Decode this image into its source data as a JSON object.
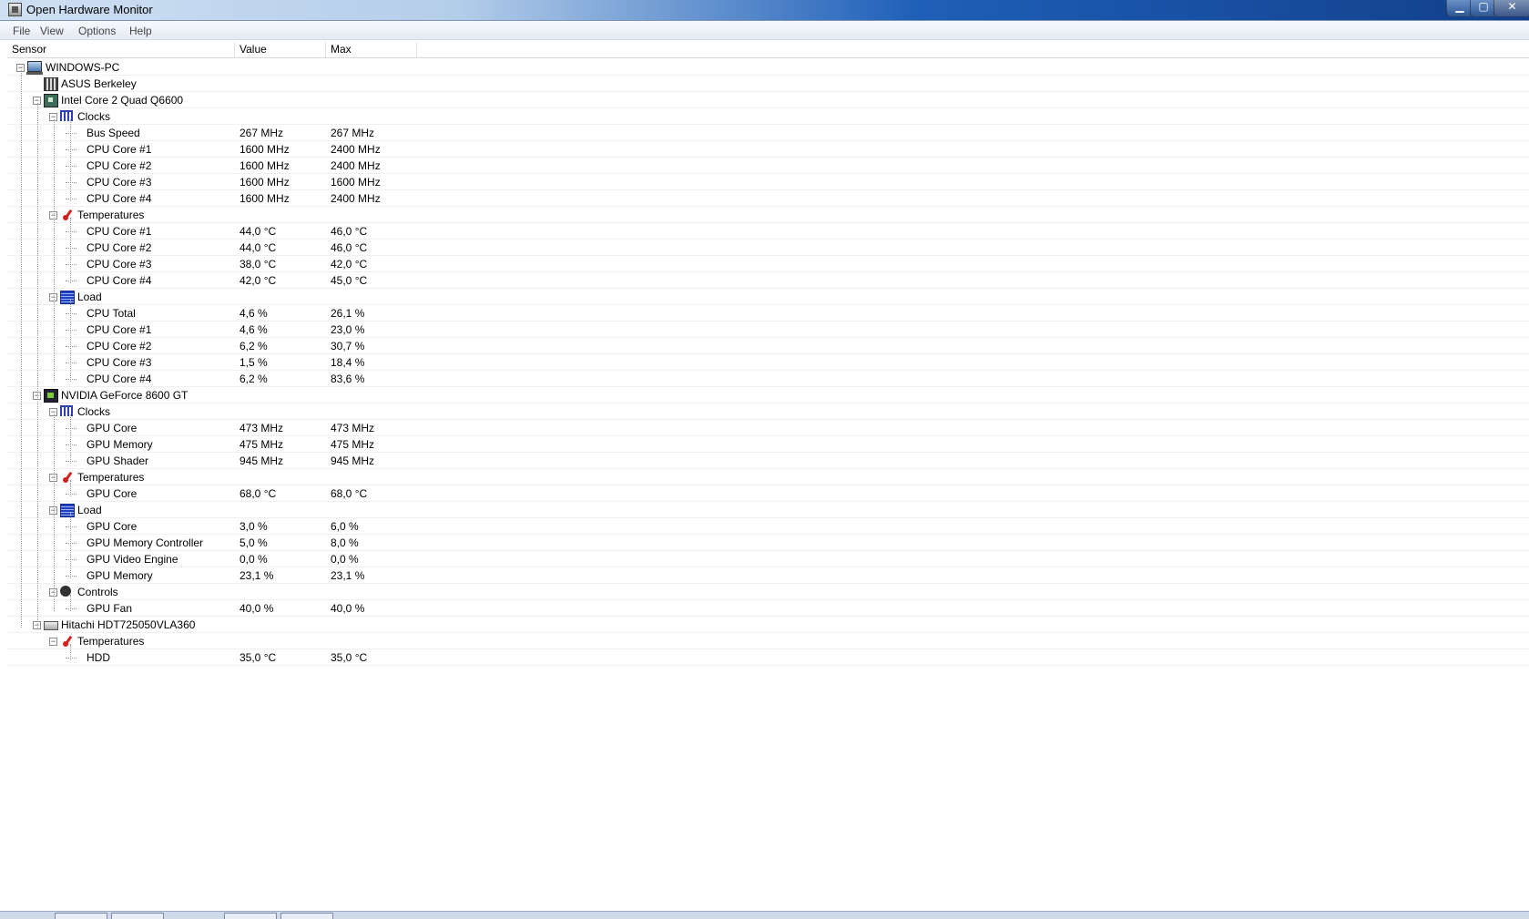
{
  "window": {
    "title": "Open Hardware Monitor",
    "controls": {
      "minimize": "▁",
      "maximize": "▢",
      "close": "✕"
    }
  },
  "menu": [
    "File",
    "View",
    "Options",
    "Help"
  ],
  "columns": {
    "sensor": "Sensor",
    "value": "Value",
    "max": "Max"
  },
  "rows": [
    {
      "level": 0,
      "expander": "−",
      "icon": "computer",
      "label": "WINDOWS-PC",
      "value": "",
      "max": ""
    },
    {
      "level": 1,
      "expander": "",
      "icon": "board",
      "label": "ASUS Berkeley",
      "value": "",
      "max": ""
    },
    {
      "level": 1,
      "expander": "−",
      "icon": "cpu",
      "label": "Intel Core 2 Quad Q6600",
      "value": "",
      "max": ""
    },
    {
      "level": 2,
      "expander": "−",
      "icon": "clock",
      "label": "Clocks",
      "value": "",
      "max": ""
    },
    {
      "level": 3,
      "expander": "",
      "icon": "",
      "label": "Bus Speed",
      "value": "267 MHz",
      "max": "267 MHz"
    },
    {
      "level": 3,
      "expander": "",
      "icon": "",
      "label": "CPU Core #1",
      "value": "1600 MHz",
      "max": "2400 MHz"
    },
    {
      "level": 3,
      "expander": "",
      "icon": "",
      "label": "CPU Core #2",
      "value": "1600 MHz",
      "max": "2400 MHz"
    },
    {
      "level": 3,
      "expander": "",
      "icon": "",
      "label": "CPU Core #3",
      "value": "1600 MHz",
      "max": "1600 MHz"
    },
    {
      "level": 3,
      "expander": "",
      "icon": "",
      "label": "CPU Core #4",
      "value": "1600 MHz",
      "max": "2400 MHz"
    },
    {
      "level": 2,
      "expander": "−",
      "icon": "temp",
      "label": "Temperatures",
      "value": "",
      "max": ""
    },
    {
      "level": 3,
      "expander": "",
      "icon": "",
      "label": "CPU Core #1",
      "value": "44,0 °C",
      "max": "46,0 °C"
    },
    {
      "level": 3,
      "expander": "",
      "icon": "",
      "label": "CPU Core #2",
      "value": "44,0 °C",
      "max": "46,0 °C"
    },
    {
      "level": 3,
      "expander": "",
      "icon": "",
      "label": "CPU Core #3",
      "value": "38,0 °C",
      "max": "42,0 °C"
    },
    {
      "level": 3,
      "expander": "",
      "icon": "",
      "label": "CPU Core #4",
      "value": "42,0 °C",
      "max": "45,0 °C"
    },
    {
      "level": 2,
      "expander": "−",
      "icon": "load",
      "label": "Load",
      "value": "",
      "max": ""
    },
    {
      "level": 3,
      "expander": "",
      "icon": "",
      "label": "CPU Total",
      "value": "4,6 %",
      "max": "26,1 %"
    },
    {
      "level": 3,
      "expander": "",
      "icon": "",
      "label": "CPU Core #1",
      "value": "4,6 %",
      "max": "23,0 %"
    },
    {
      "level": 3,
      "expander": "",
      "icon": "",
      "label": "CPU Core #2",
      "value": "6,2 %",
      "max": "30,7 %"
    },
    {
      "level": 3,
      "expander": "",
      "icon": "",
      "label": "CPU Core #3",
      "value": "1,5 %",
      "max": "18,4 %"
    },
    {
      "level": 3,
      "expander": "",
      "icon": "",
      "label": "CPU Core #4",
      "value": "6,2 %",
      "max": "83,6 %"
    },
    {
      "level": 1,
      "expander": "−",
      "icon": "gpu",
      "label": "NVIDIA GeForce 8600 GT",
      "value": "",
      "max": ""
    },
    {
      "level": 2,
      "expander": "−",
      "icon": "clock",
      "label": "Clocks",
      "value": "",
      "max": ""
    },
    {
      "level": 3,
      "expander": "",
      "icon": "",
      "label": "GPU Core",
      "value": "473 MHz",
      "max": "473 MHz"
    },
    {
      "level": 3,
      "expander": "",
      "icon": "",
      "label": "GPU Memory",
      "value": "475 MHz",
      "max": "475 MHz"
    },
    {
      "level": 3,
      "expander": "",
      "icon": "",
      "label": "GPU Shader",
      "value": "945 MHz",
      "max": "945 MHz"
    },
    {
      "level": 2,
      "expander": "−",
      "icon": "temp",
      "label": "Temperatures",
      "value": "",
      "max": ""
    },
    {
      "level": 3,
      "expander": "",
      "icon": "",
      "label": "GPU Core",
      "value": "68,0 °C",
      "max": "68,0 °C"
    },
    {
      "level": 2,
      "expander": "−",
      "icon": "load",
      "label": "Load",
      "value": "",
      "max": ""
    },
    {
      "level": 3,
      "expander": "",
      "icon": "",
      "label": "GPU Core",
      "value": "3,0 %",
      "max": "6,0 %"
    },
    {
      "level": 3,
      "expander": "",
      "icon": "",
      "label": "GPU Memory Controller",
      "value": "5,0 %",
      "max": "8,0 %"
    },
    {
      "level": 3,
      "expander": "",
      "icon": "",
      "label": "GPU Video Engine",
      "value": "0,0 %",
      "max": "0,0 %"
    },
    {
      "level": 3,
      "expander": "",
      "icon": "",
      "label": "GPU Memory",
      "value": "23,1 %",
      "max": "23,1 %"
    },
    {
      "level": 2,
      "expander": "−",
      "icon": "fan",
      "label": "Controls",
      "value": "",
      "max": ""
    },
    {
      "level": 3,
      "expander": "",
      "icon": "",
      "label": "GPU Fan",
      "value": "40,0 %",
      "max": "40,0 %"
    },
    {
      "level": 1,
      "expander": "−",
      "icon": "hdd",
      "label": "Hitachi HDT725050VLA360",
      "value": "",
      "max": ""
    },
    {
      "level": 2,
      "expander": "−",
      "icon": "temp",
      "label": "Temperatures",
      "value": "",
      "max": ""
    },
    {
      "level": 3,
      "expander": "",
      "icon": "",
      "label": "HDD",
      "value": "35,0 °C",
      "max": "35,0 °C"
    }
  ]
}
